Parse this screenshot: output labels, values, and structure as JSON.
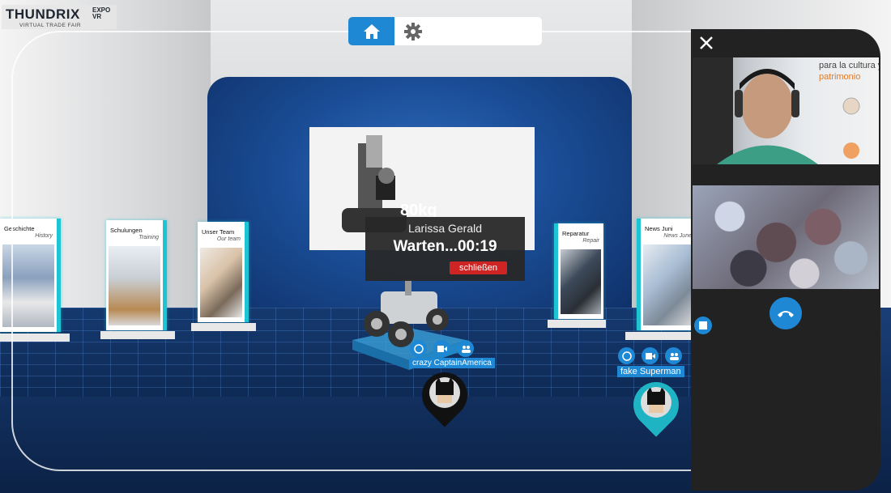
{
  "logo": {
    "brand": "THUNDRIX",
    "expo_line1": "EXPO",
    "expo_line2": "VR",
    "subtitle": "VIRTUAL TRADE FAIR"
  },
  "toolbar": {
    "home_icon": "home-icon",
    "settings_icon": "gear-icon"
  },
  "banners": [
    {
      "title": "Geschichte",
      "subtitle": "History"
    },
    {
      "title": "Schulungen",
      "subtitle": "Training"
    },
    {
      "title": "Unser Team",
      "subtitle": "Our team"
    },
    {
      "title": "Reparatur",
      "subtitle": "Repair"
    },
    {
      "title": "News Juni",
      "subtitle": "News June"
    }
  ],
  "screen": {
    "weight_text": "80kg"
  },
  "call_popup": {
    "caller": "Larissa Gerald",
    "status": "Warten...00:19",
    "close_label": "schließen"
  },
  "users": [
    {
      "name": "crazy CaptainAmerica",
      "pin_color": "#111111"
    },
    {
      "name": "fake Superman",
      "pin_color": "#1fb4c4"
    }
  ],
  "video_panel": {
    "close_icon": "close-icon",
    "hangup_icon": "phone-hangup-icon",
    "stop_icon": "stop-icon",
    "wall_text_1": "para la cultura y el",
    "wall_text_2": "patrimonio"
  },
  "colors": {
    "accent": "#1e88d4",
    "danger": "#cf2424",
    "teal": "#1fc4d4"
  }
}
